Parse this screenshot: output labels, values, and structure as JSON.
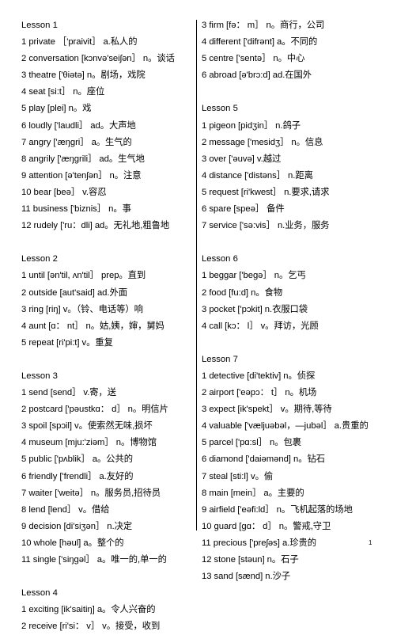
{
  "document": {
    "page_number": "1",
    "columns": [
      {
        "side": "left",
        "blocks": [
          {
            "heading": "Lesson 1",
            "entries": [
              "1 private  ［'praivit］ a.私人的",
              "2 conversation [kɔnvə'seiʃən］ n。谈话",
              "3 theatre  ['θiətə] n。剧场，戏院",
              "4 seat  [si:t］ n。座位",
              "5 play  [plei] n。戏",
              "6 loudly ['laudli］ ad。大声地",
              "7 angry ['æŋgri］ a。生气的",
              "8 angrily ['æŋgrili］ ad。生气地",
              "9 attention [ə'tenʃən］ n。注意",
              "10 bear  [beə］ v.容忍",
              "11 business  ['biznis］ n。事",
              "12 rudely  ['ru：dli] ad。无礼地,粗鲁地"
            ]
          },
          {
            "heading": "Lesson 2",
            "entries": [
              "1 until  [ən'til, ʌn'til］ prep。直到",
              "2 outside  [aut'said] ad.外面",
              "3 ring  [riŋ] v。（铃、电话等）响",
              "4 aunt  [ɑ： nt］ n。姑,姨，婶，舅妈",
              "5 repeat [ri'pi:t] v。重复"
            ]
          },
          {
            "heading": "Lesson 3",
            "entries": [
              "1 send  [send］ v.寄，送",
              "2 postcard  ['pəustkɑ： d］ n。明信片",
              "3 spoil [spɔil] v。使索然无味,损坏",
              "4 museum  [mju:'ziəm］ n。博物馆",
              "5 public  ['pʌblik］ a。公共的",
              "6 friendly  ['frendli］ a.友好的",
              "7 waiter  ['weitə］ n。服务员,招待员",
              "8 lend [lend］ v。借给",
              "9 decision  [di'siʒən］ n.决定",
              "10 whole  [həul] a。整个的",
              "11 single ['siŋgəl］ a。唯一的,单一的"
            ]
          },
          {
            "heading": "Lesson 4",
            "entries": [
              "1 exciting  [ik'saitiŋ] a。令人兴奋的",
              "2 receive  [ri'si： v］ v。接受，收到"
            ]
          }
        ]
      },
      {
        "side": "right",
        "blocks": [
          {
            "heading": "",
            "entries": [
              "3 firm  [fə： m］ n。商行，公司",
              "4 different  ['difrənt] a。不同的",
              "5 centre ['sentə］ n。中心",
              "6 abroad [ə'brɔ:d] ad.在国外"
            ]
          },
          {
            "heading": "Lesson 5",
            "entries": [
              "1 pigeon [pidʒin］ n.鸽子",
              "2 message  ['mesidʒ］ n。信息",
              "3 over  ['əuvə] v.越过",
              "4 distance ['distəns］ n.距离",
              "5 request  [ri'kwest］ n.要求,请求",
              "6 spare  [speə］ 备件",
              "7 service ['sə:vis］ n.业务，服务"
            ]
          },
          {
            "heading": "Lesson 6",
            "entries": [
              "1 beggar  ['begə］ n。乞丐",
              "2 food  [fu:d] n。食物",
              "3 pocket  ['pɔkit] n.衣服口袋",
              "4 call [kɔ： l］ v。拜访，光顾"
            ]
          },
          {
            "heading": "Lesson 7",
            "entries": [
              "1 detective  [di'tektiv] n。侦探",
              "2 airport  ['eəpɔ： t］ n。机场",
              "3 expect  [ik'spekt］ v。期待,等待",
              "4 valuable  ['væljuəbəl，—jubəl］ a.贵重的",
              "5 parcel  ['pɑ:sl］ n。包裹",
              "6 diamond ['daiəmənd] n。钻石",
              "7 steal  [sti:l] v。偷",
              "8 main [mein］ a。主要的",
              "9 airfield  ['eəfi:ld］ n。飞机起落的场地",
              "10 guard  [gɑ： d］ n。警戒,守卫",
              "11 precious ['preʃəs] a.珍贵的",
              "12 stone [stəun] n。石子",
              "13 sand [sænd] n.沙子"
            ]
          }
        ]
      }
    ]
  }
}
